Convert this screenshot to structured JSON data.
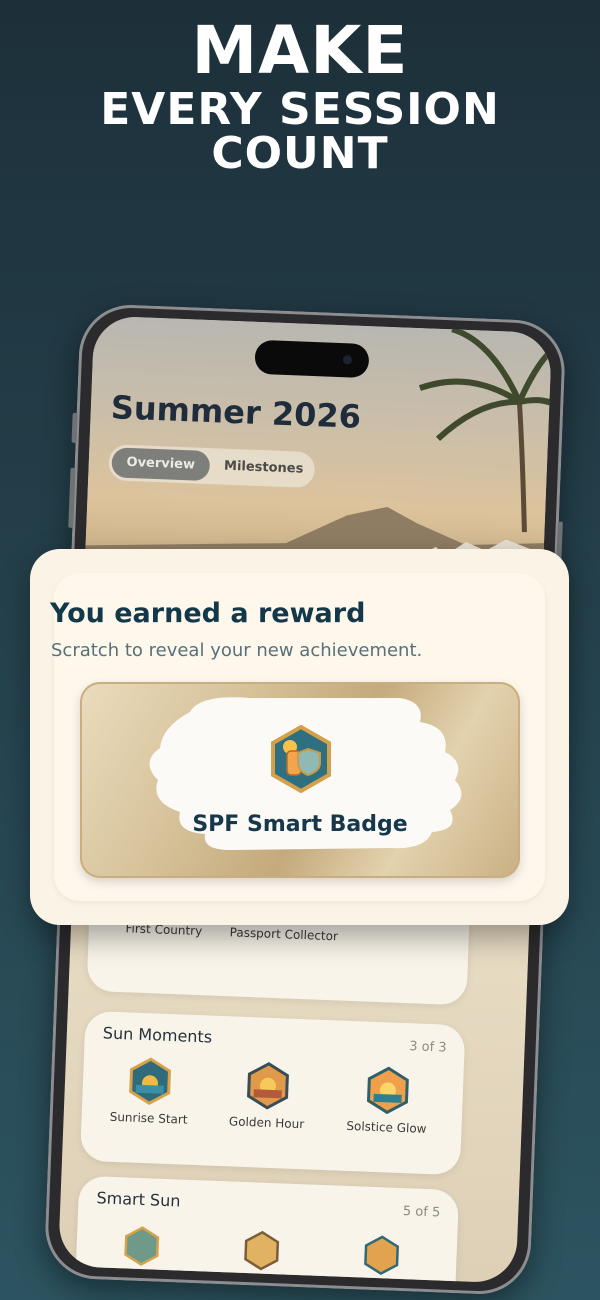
{
  "headline": {
    "line1": "MAKE",
    "line2": "EVERY SESSION",
    "line3": "COUNT"
  },
  "screen": {
    "title": "Summer 2026",
    "tabs": [
      {
        "label": "Overview",
        "active": true
      },
      {
        "label": "Milestones",
        "active": false
      }
    ],
    "sections": [
      {
        "title": "",
        "count": "",
        "badges": [
          {
            "label": "First Country"
          },
          {
            "label": "Passport Collector"
          }
        ]
      },
      {
        "title": "Sun Moments",
        "count": "3 of 3",
        "badges": [
          {
            "label": "Sunrise Start"
          },
          {
            "label": "Golden Hour"
          },
          {
            "label": "Solstice Glow"
          }
        ]
      },
      {
        "title": "Smart Sun",
        "count": "5 of 5",
        "badges": []
      }
    ]
  },
  "reward": {
    "title": "You earned a reward",
    "subtitle": "Scratch to reveal your new achievement.",
    "badge_name": "SPF Smart Badge"
  },
  "colors": {
    "background": "#24404b",
    "accent": "#13384a",
    "card": "#fdf7ec"
  }
}
